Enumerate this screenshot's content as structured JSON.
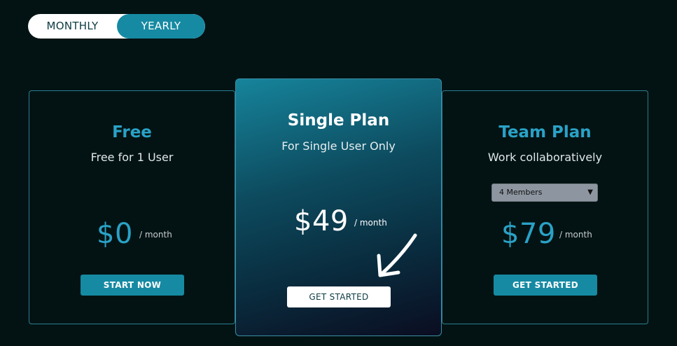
{
  "billing_toggle": {
    "monthly_label": "MONTHLY",
    "yearly_label": "YEARLY",
    "selected": "yearly"
  },
  "plans": [
    {
      "name": "Free",
      "subtitle": "Free for 1 User",
      "price": "$0",
      "period": "/ month",
      "button_label": "START NOW"
    },
    {
      "name": "Single Plan",
      "subtitle": "For Single User Only",
      "price": "$49",
      "period": "/ month",
      "button_label": "GET STARTED"
    },
    {
      "name": "Team Plan",
      "subtitle": "Work collaboratively",
      "members_select": {
        "selected": "4 Members"
      },
      "price": "$79",
      "period": "/ month",
      "button_label": "GET STARTED"
    }
  ],
  "colors": {
    "background": "#031313",
    "accent": "#168aa3",
    "accent_text": "#2aa2c7"
  },
  "icons": {
    "arrow": "arrow-down-left-icon",
    "dropdown": "chevron-down-icon"
  }
}
